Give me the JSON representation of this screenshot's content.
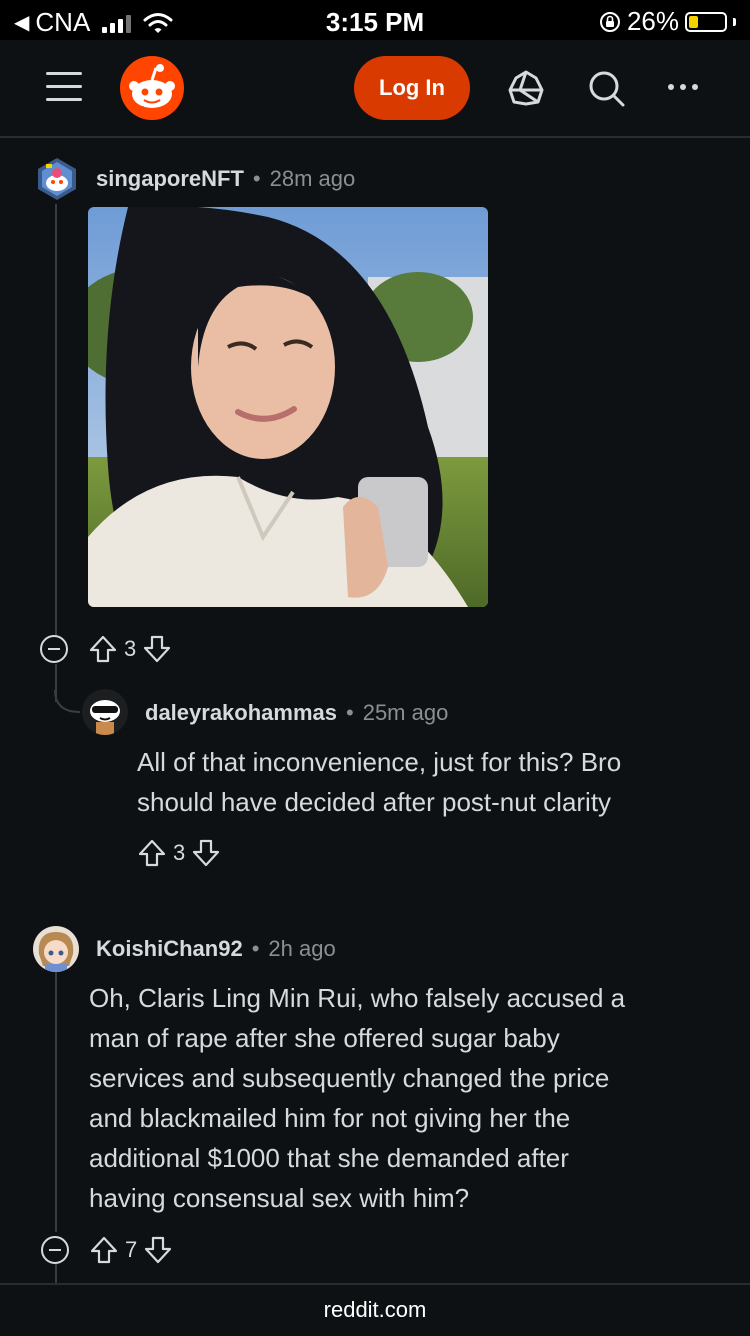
{
  "status_bar": {
    "back_app": "CNA",
    "time": "3:15 PM",
    "battery_percent": "26%",
    "battery_level": 0.26
  },
  "header": {
    "login_label": "Log In",
    "icons": [
      "menu-icon",
      "reddit-logo",
      "popular-icon",
      "search-icon",
      "more-icon"
    ]
  },
  "comments": [
    {
      "author": "singaporeNFT",
      "time": "28m ago",
      "has_image": true,
      "score": "3"
    },
    {
      "author": "daleyrakohammas",
      "time": "25m ago",
      "body_lines": [
        "All of that inconvenience, just for this? Bro",
        "should have decided after post-nut clarity"
      ],
      "score": "3"
    },
    {
      "author": "KoishiChan92",
      "time": "2h ago",
      "body_lines": [
        "Oh, Claris Ling Min Rui, who falsely accused a",
        "man of rape after she offered sugar baby",
        "services and subsequently changed the price",
        "and blackmailed him for not giving her the",
        "additional $1000 that she demanded after",
        "having consensual sex with him?"
      ],
      "score": "7"
    }
  ],
  "footer": {
    "url": "reddit.com"
  },
  "colors": {
    "background": "#0e1113",
    "accent": "#d93a00",
    "reddit_orange": "#ff4500",
    "meta_text": "#8b8f93"
  }
}
